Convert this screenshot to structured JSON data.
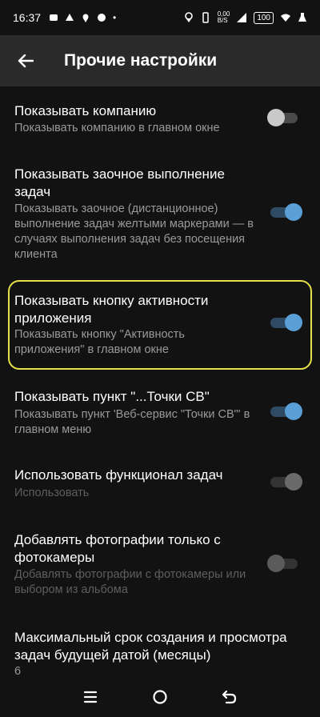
{
  "status_bar": {
    "time": "16:37",
    "left_icons": [
      "notification-icon",
      "notification-icon",
      "location-pin-icon",
      "notification-icon"
    ],
    "dot": "•",
    "network_speed_top": "0,00",
    "network_speed_bottom": "B/S",
    "battery": "100"
  },
  "header": {
    "title": "Прочие настройки"
  },
  "settings": [
    {
      "title": "Показывать компанию",
      "summary": "Показывать компанию в главном окне",
      "state": "off"
    },
    {
      "title": "Показывать заочное выполнение задач",
      "summary": "Показывать заочное (дистанционное) выполнение задач желтыми маркерами — в случаях выполнения задач без посещения клиента",
      "state": "on"
    },
    {
      "title": "Показывать кнопку активности приложения",
      "summary": "Показывать кнопку \"Активность приложения\" в главном окне",
      "state": "on"
    },
    {
      "title": "Показывать пункт \"...Точки СВ\"",
      "summary": "Показывать пункт 'Веб-сервис \"Точки СВ\"' в главном меню",
      "state": "on"
    },
    {
      "title": "Использовать функционал задач",
      "summary": "Использовать",
      "state": "disabled-on"
    },
    {
      "title": "Добавлять фотографии только с фотокамеры",
      "summary": "Добавлять фотографии с фотокамеры или выбором из альбома",
      "state": "disabled-off"
    },
    {
      "title": "Максимальный срок создания и просмотра задач будущей датой (месяцы)",
      "summary": "6"
    }
  ],
  "colors": {
    "accent": "#5a9fd6",
    "highlight": "#e6e04a",
    "background": "#121212",
    "app_bar": "#2a2a2a"
  },
  "nav": {
    "items": [
      "menu-icon",
      "home-icon",
      "back-icon"
    ]
  }
}
